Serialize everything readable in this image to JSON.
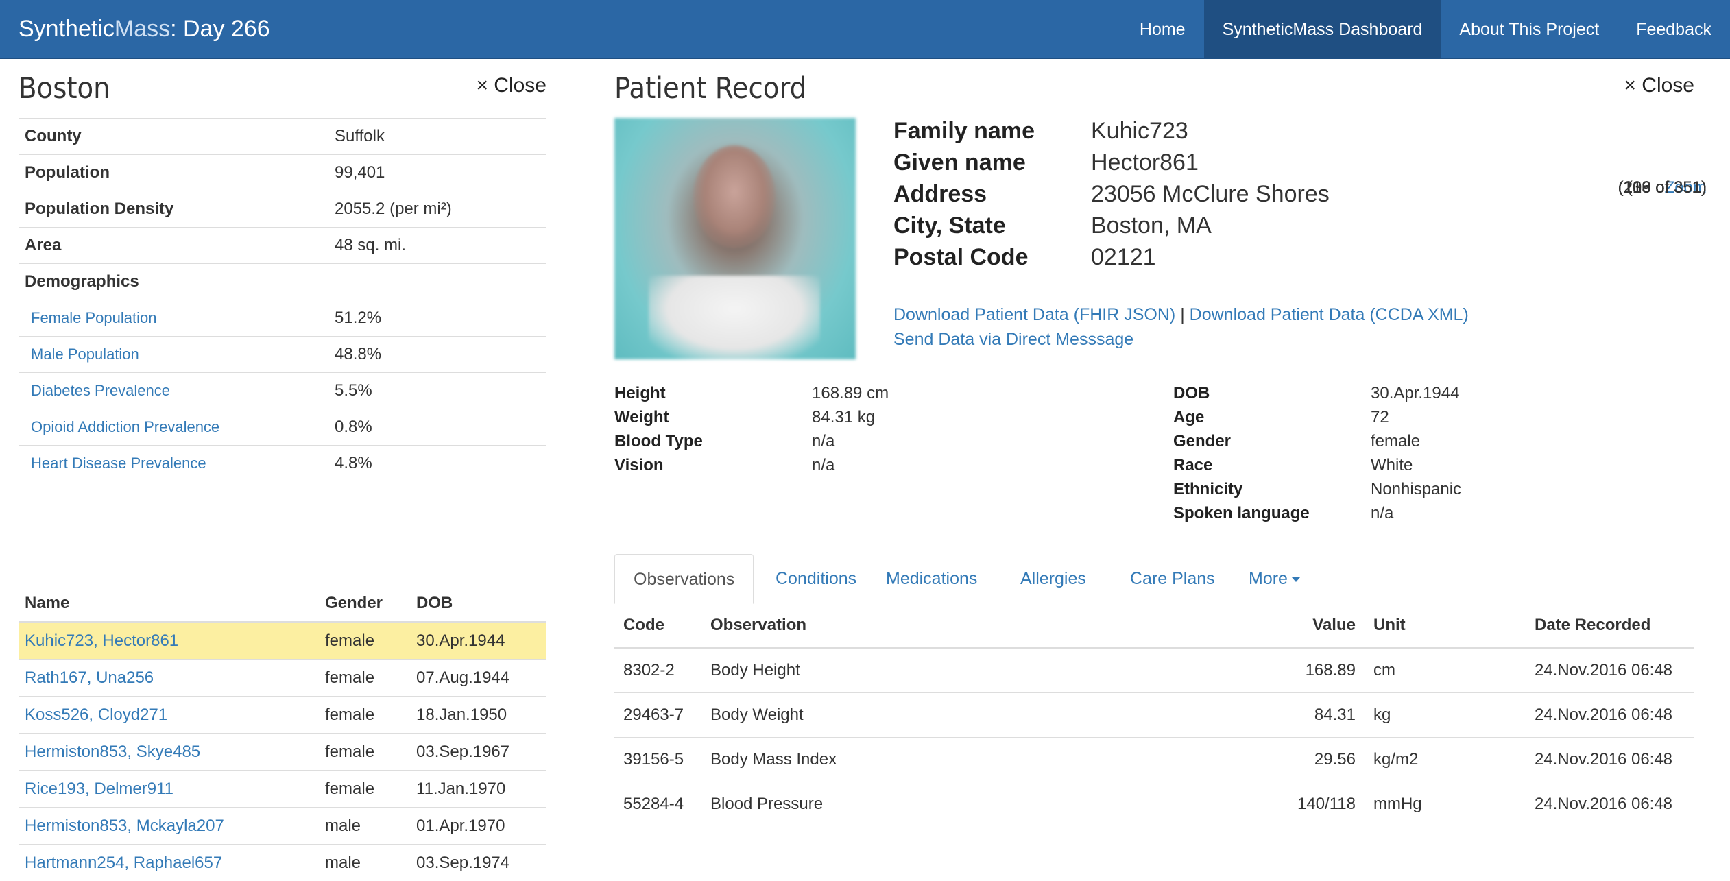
{
  "navbar": {
    "brand_prefix": "Synthetic",
    "brand_light": "Mass",
    "brand_suffix": ": Day 266",
    "items": [
      {
        "label": "Home"
      },
      {
        "label": "SyntheticMass Dashboard",
        "active": true
      },
      {
        "label": "About This Project"
      },
      {
        "label": "Feedback"
      }
    ]
  },
  "city_panel": {
    "title": "Boston",
    "close_label": "× Close",
    "rows": {
      "county": {
        "label": "County",
        "value": "Suffolk"
      },
      "population": {
        "label": "Population",
        "value": "99,401"
      },
      "density": {
        "label": "Population Density",
        "value": "2055.2 (per mi²)"
      },
      "area": {
        "label": "Area",
        "value": "48 sq. mi.",
        "action": "Zoom"
      },
      "demographics": {
        "label": "Demographics"
      }
    },
    "stats": [
      {
        "label": "Female Population",
        "value": "51.2%",
        "count": "(216 of 351)"
      },
      {
        "label": "Male Population",
        "value": "48.8%",
        "count": "(136 of 351)"
      },
      {
        "label": "Diabetes Prevalence",
        "value": "5.5%",
        "count": "(216 of 351)"
      },
      {
        "label": "Opioid Addiction Prevalence",
        "value": "0.8%",
        "count": "(109 of 351)"
      },
      {
        "label": "Heart Disease Prevalence",
        "value": "4.8%",
        "count": "(18 of 351)"
      }
    ],
    "people_headers": {
      "name": "Name",
      "gender": "Gender",
      "dob": "DOB"
    },
    "people": [
      {
        "name": "Kuhic723, Hector861",
        "gender": "female",
        "dob": "30.Apr.1944",
        "selected": true
      },
      {
        "name": "Rath167, Una256",
        "gender": "female",
        "dob": "07.Aug.1944"
      },
      {
        "name": "Koss526, Cloyd271",
        "gender": "female",
        "dob": "18.Jan.1950"
      },
      {
        "name": "Hermiston853, Skye485",
        "gender": "female",
        "dob": "03.Sep.1967"
      },
      {
        "name": "Rice193, Delmer911",
        "gender": "female",
        "dob": "11.Jan.1970"
      },
      {
        "name": "Hermiston853, Mckayla207",
        "gender": "male",
        "dob": "01.Apr.1970"
      },
      {
        "name": "Hartmann254, Raphael657",
        "gender": "male",
        "dob": "03.Sep.1974"
      }
    ]
  },
  "patient": {
    "title": "Patient Record",
    "close_label": "× Close",
    "demographics": {
      "family": {
        "label": "Family name",
        "value": "Kuhic723"
      },
      "given": {
        "label": "Given name",
        "value": "Hector861"
      },
      "address": {
        "label": "Address",
        "value": "23056 McClure Shores"
      },
      "city": {
        "label": "City, State",
        "value": "Boston, MA"
      },
      "postal": {
        "label": "Postal Code",
        "value": "02121"
      }
    },
    "downloads": {
      "fhir": "Download Patient Data (FHIR JSON)",
      "separator": "|",
      "ccda": "Download Patient Data (CCDA XML)",
      "direct": "Send Data via Direct Messsage"
    },
    "vitals_left": {
      "height": {
        "label": "Height",
        "value": "168.89 cm"
      },
      "weight": {
        "label": "Weight",
        "value": "84.31 kg"
      },
      "blood": {
        "label": "Blood Type",
        "value": "n/a"
      },
      "vision": {
        "label": "Vision",
        "value": "n/a"
      }
    },
    "vitals_right": {
      "dob": {
        "label": "DOB",
        "value": "30.Apr.1944"
      },
      "age": {
        "label": "Age",
        "value": "72"
      },
      "gender": {
        "label": "Gender",
        "value": "female"
      },
      "race": {
        "label": "Race",
        "value": "White"
      },
      "ethnicity": {
        "label": "Ethnicity",
        "value": "Nonhispanic"
      },
      "language": {
        "label": "Spoken language",
        "value": "n/a"
      }
    },
    "tabs": {
      "observations": "Observations",
      "conditions": "Conditions",
      "medications": "Medications",
      "allergies": "Allergies",
      "careplans": "Care Plans",
      "more": "More"
    },
    "obs_headers": {
      "code": "Code",
      "observation": "Observation",
      "value": "Value",
      "unit": "Unit",
      "date": "Date Recorded"
    },
    "observations": [
      {
        "code": "8302-2",
        "observation": "Body Height",
        "value": "168.89",
        "unit": "cm",
        "date": "24.Nov.2016 06:48"
      },
      {
        "code": "29463-7",
        "observation": "Body Weight",
        "value": "84.31",
        "unit": "kg",
        "date": "24.Nov.2016 06:48"
      },
      {
        "code": "39156-5",
        "observation": "Body Mass Index",
        "value": "29.56",
        "unit": "kg/m2",
        "date": "24.Nov.2016 06:48"
      },
      {
        "code": "55284-4",
        "observation": "Blood Pressure",
        "value": "140/118",
        "unit": "mmHg",
        "date": "24.Nov.2016 06:48"
      }
    ]
  },
  "colors": {
    "navbar": "#2b67a5",
    "link": "#337ab7",
    "selected_row": "#fcefa1"
  }
}
